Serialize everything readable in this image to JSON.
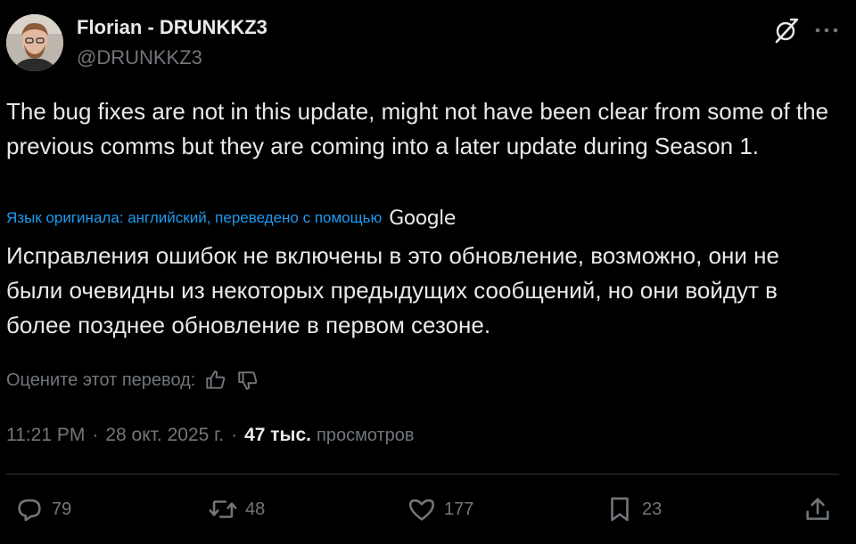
{
  "author": {
    "name": "Florian - DRUNKKZ3",
    "handle": "@DRUNKKZ3"
  },
  "header_icons": [
    "grok-icon",
    "more-icon"
  ],
  "tweet": {
    "text": "The bug fixes are not in this update, might not have been clear from some of the previous comms but they are coming into a later update during Season 1.",
    "translation_label": "Язык оригинала: английский, переведено с помощью",
    "translation_provider": "Google",
    "translated_text": "Исправления ошибок не включены в это обновление, возможно, они не были очевидны из некоторых предыдущих сообщений, но они войдут в более позднее обновление в первом сезоне.",
    "rate_label": "Оцените этот перевод:"
  },
  "meta": {
    "time": "11:21 PM",
    "date": "28 окт. 2025 г.",
    "separator": "·",
    "views_count": "47 тыс.",
    "views_label": "просмотров"
  },
  "actions": {
    "replies": "79",
    "reposts": "48",
    "likes": "177",
    "bookmarks": "23"
  },
  "colors": {
    "background": "#000000",
    "text": "#e7e9ea",
    "secondary": "#71767b",
    "accent": "#1d9bf0",
    "divider": "#2f3336"
  }
}
